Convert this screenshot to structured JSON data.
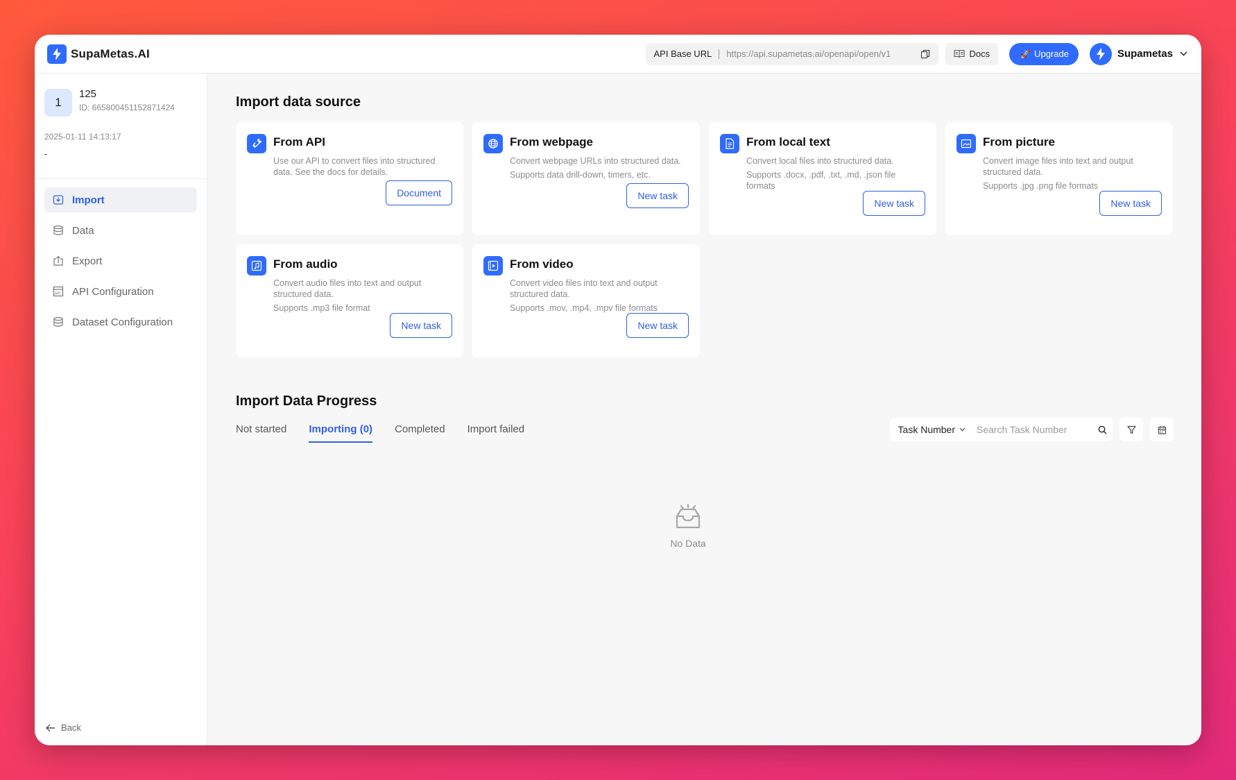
{
  "app": {
    "name": "SupaMetas.AI"
  },
  "header": {
    "api_label": "API Base URL",
    "api_url": "https://api.supametas.ai/openapi/open/v1",
    "docs_label": "Docs",
    "upgrade_label": "Upgrade",
    "user_name": "Supametas"
  },
  "profile": {
    "avatar_text": "1",
    "name": "125",
    "id": "ID: 665800451152871424",
    "date": "2025-01-11 14:13:17",
    "note": "-"
  },
  "sidebar": {
    "items": [
      {
        "label": "Import",
        "icon": "import-icon",
        "active": true
      },
      {
        "label": "Data",
        "icon": "database-icon"
      },
      {
        "label": "Export",
        "icon": "export-icon"
      },
      {
        "label": "API Configuration",
        "icon": "api-icon"
      },
      {
        "label": "Dataset Configuration",
        "icon": "dataset-icon"
      }
    ],
    "back_label": "Back"
  },
  "import_section": {
    "title": "Import data source",
    "cards": [
      {
        "title": "From API",
        "desc": [
          "Use our API to convert files into structured data. See the docs for details."
        ],
        "button": "Document",
        "icon": "link-icon"
      },
      {
        "title": "From webpage",
        "desc": [
          "Convert webpage URLs into structured data.",
          "Supports data drill-down, timers, etc."
        ],
        "button": "New task",
        "icon": "globe-icon"
      },
      {
        "title": "From local text",
        "desc": [
          "Convert local files into structured data.",
          "Supports .docx, .pdf, .txt, .md, .json file formats"
        ],
        "button": "New task",
        "icon": "document-icon"
      },
      {
        "title": "From picture",
        "desc": [
          "Convert image files into text and output structured data.",
          "Supports .jpg .png file formats"
        ],
        "button": "New task",
        "icon": "image-icon"
      },
      {
        "title": "From audio",
        "desc": [
          "Convert audio files into text and output structured data.",
          "Supports .mp3 file format"
        ],
        "button": "New task",
        "icon": "audio-icon"
      },
      {
        "title": "From video",
        "desc": [
          "Convert video files into text and output structured data.",
          "Supports .mov, .mp4, .mpv file formats"
        ],
        "button": "New task",
        "icon": "video-icon"
      }
    ]
  },
  "progress_section": {
    "title": "Import Data Progress",
    "tabs": [
      {
        "label": "Not started"
      },
      {
        "label": "Importing (0)",
        "active": true
      },
      {
        "label": "Completed"
      },
      {
        "label": "Import failed"
      }
    ],
    "filter_select": "Task Number",
    "search_placeholder": "Search Task Number",
    "empty_text": "No Data"
  },
  "colors": {
    "accent": "#2f6bff",
    "link": "#2f5fe8"
  }
}
